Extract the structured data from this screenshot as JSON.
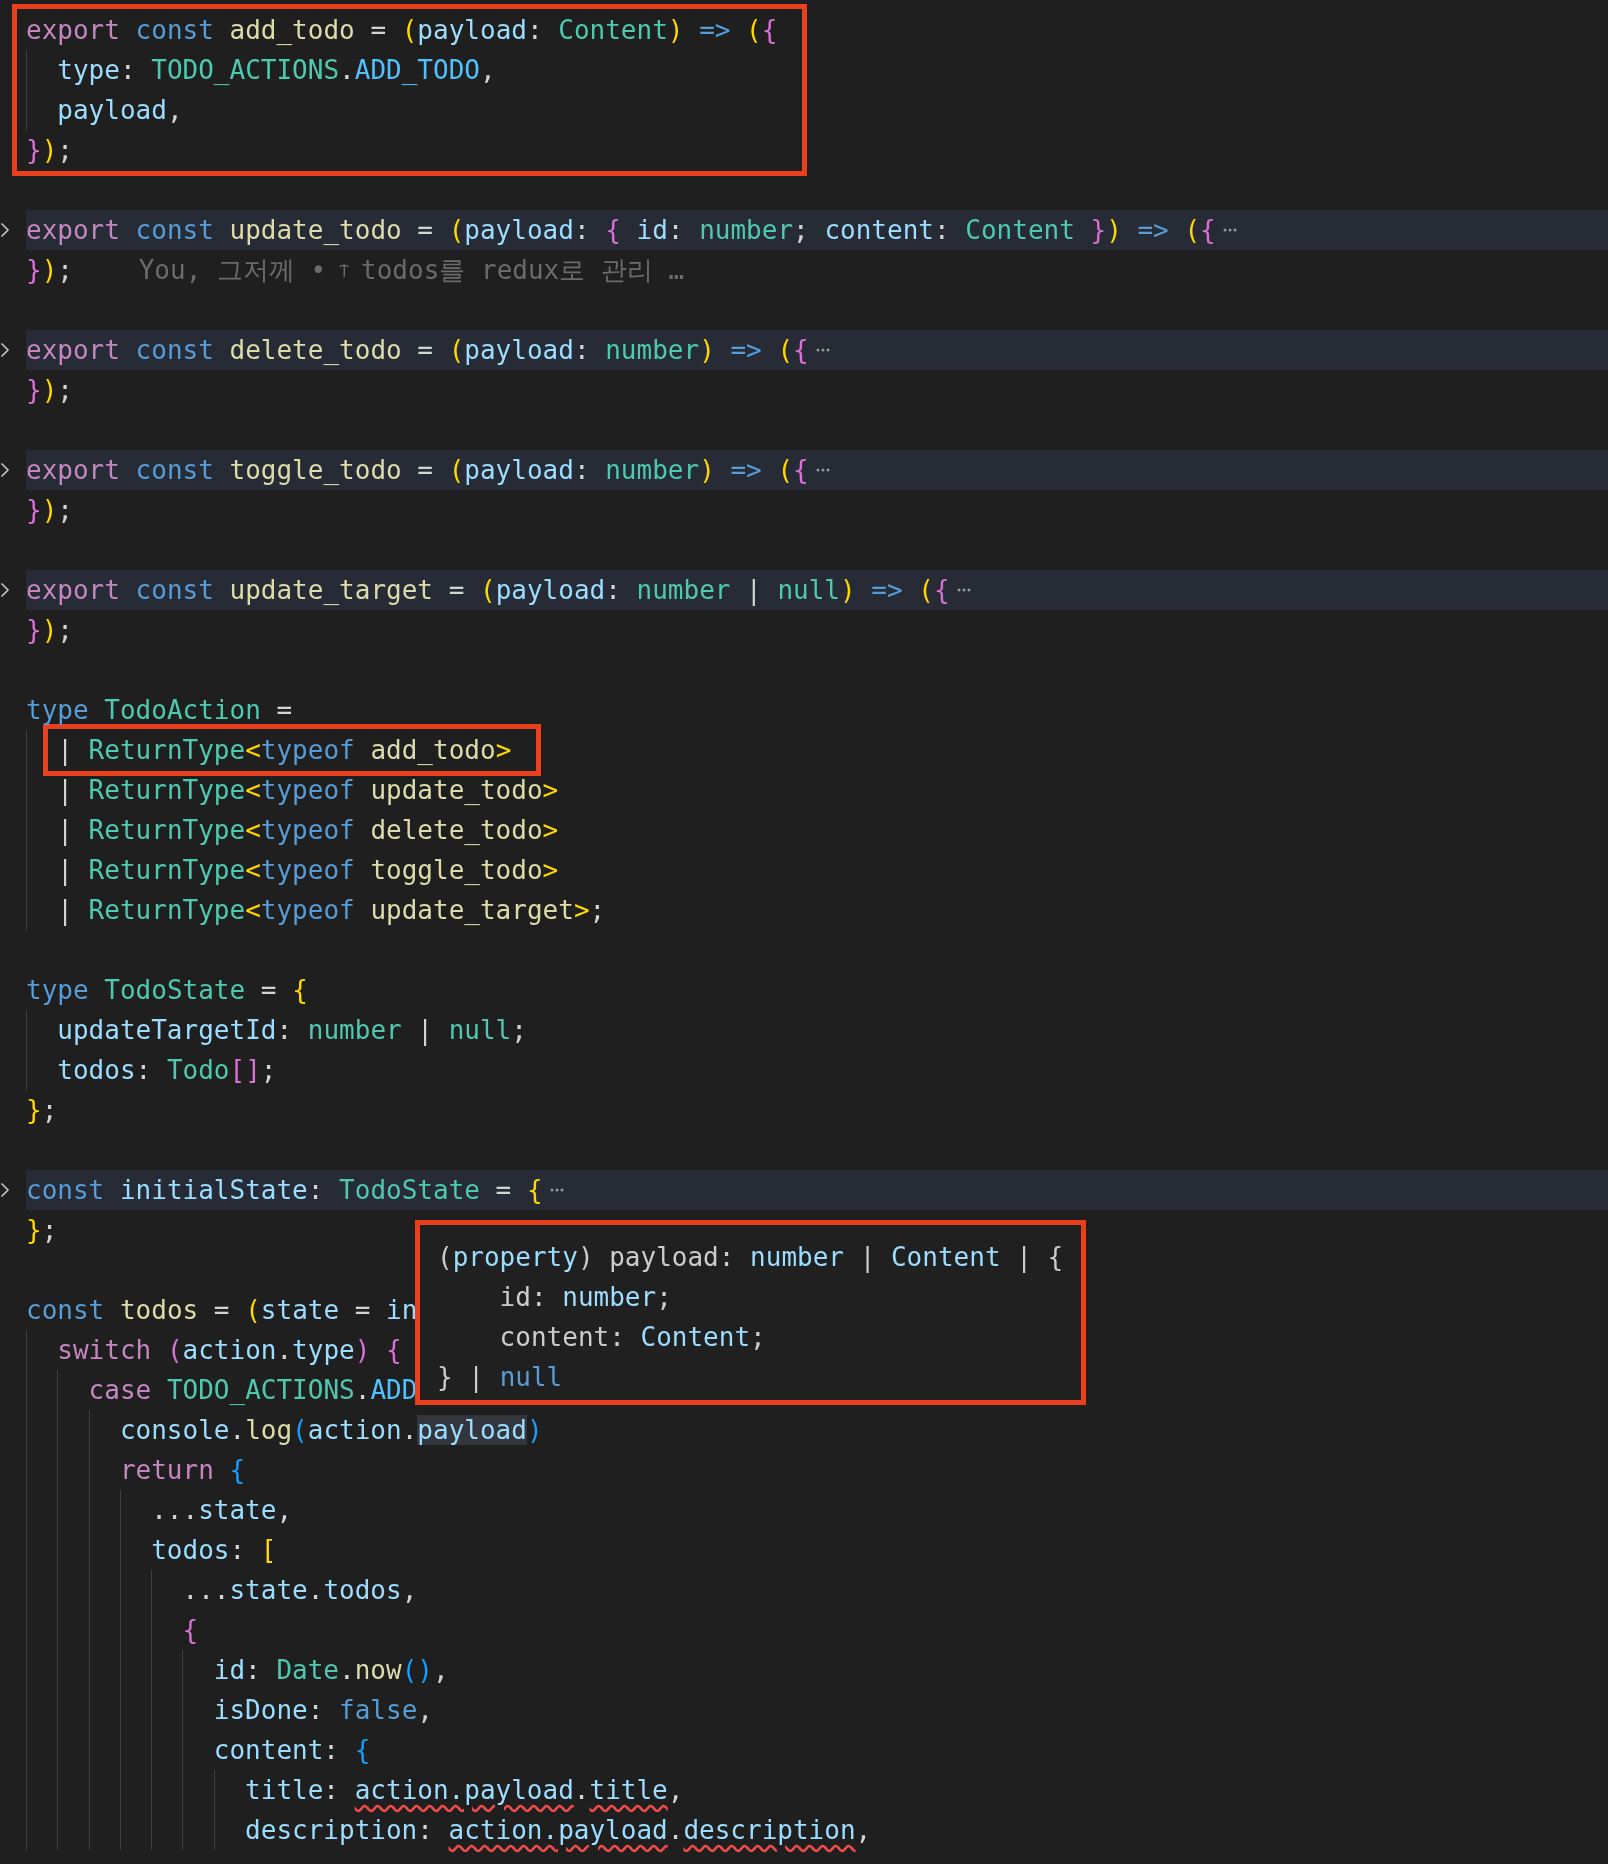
{
  "editor": {
    "lines": [
      {
        "kind": "boxed",
        "tokens": [
          {
            "kind": "kw",
            "text": "export "
          },
          {
            "kind": "st",
            "text": "const "
          },
          {
            "kind": "fn",
            "text": "add_todo"
          },
          {
            "kind": "p",
            "text": " = "
          },
          {
            "kind": "b1",
            "text": "("
          },
          {
            "kind": "var",
            "text": "payload"
          },
          {
            "kind": "p",
            "text": ": "
          },
          {
            "kind": "ty",
            "text": "Content"
          },
          {
            "kind": "b1",
            "text": ") "
          },
          {
            "kind": "st",
            "text": "=> "
          },
          {
            "kind": "b1",
            "text": "("
          },
          {
            "kind": "b2",
            "text": "{"
          }
        ],
        "children": [
          {
            "kind": "plain",
            "tokens": [
              {
                "kind": "var",
                "text": "type"
              },
              {
                "kind": "p",
                "text": ": "
              },
              {
                "kind": "ty",
                "text": "TODO_ACTIONS"
              },
              {
                "kind": "p",
                "text": "."
              },
              {
                "kind": "cn",
                "text": "ADD_TODO"
              },
              {
                "kind": "p",
                "text": ","
              }
            ]
          },
          {
            "kind": "plain",
            "tokens": [
              {
                "kind": "var",
                "text": "payload"
              },
              {
                "kind": "p",
                "text": ","
              }
            ]
          }
        ],
        "close": [
          {
            "kind": "b2",
            "text": "}"
          },
          {
            "kind": "b1",
            "text": ")"
          },
          {
            "kind": "p",
            "text": ";"
          }
        ]
      },
      {
        "kind": "blank"
      },
      {
        "kind": "folded",
        "tokens": [
          {
            "kind": "kw",
            "text": "export "
          },
          {
            "kind": "st",
            "text": "const "
          },
          {
            "kind": "fn",
            "text": "update_todo"
          },
          {
            "kind": "p",
            "text": " = "
          },
          {
            "kind": "b1",
            "text": "("
          },
          {
            "kind": "var",
            "text": "payload"
          },
          {
            "kind": "p",
            "text": ": "
          },
          {
            "kind": "b2",
            "text": "{ "
          },
          {
            "kind": "var",
            "text": "id"
          },
          {
            "kind": "p",
            "text": ": "
          },
          {
            "kind": "ty",
            "text": "number"
          },
          {
            "kind": "p",
            "text": "; "
          },
          {
            "kind": "var",
            "text": "content"
          },
          {
            "kind": "p",
            "text": ": "
          },
          {
            "kind": "ty",
            "text": "Content "
          },
          {
            "kind": "b2",
            "text": "}"
          },
          {
            "kind": "b1",
            "text": ") "
          },
          {
            "kind": "st",
            "text": "=> "
          },
          {
            "kind": "b1",
            "text": "("
          },
          {
            "kind": "b2",
            "text": "{"
          }
        ],
        "close": [
          {
            "kind": "b2",
            "text": "}"
          },
          {
            "kind": "b1",
            "text": ")"
          },
          {
            "kind": "p",
            "text": ";"
          }
        ],
        "blame": {
          "author": "You, 그저께 •",
          "message": "todos를 redux로 관리 …"
        }
      },
      {
        "kind": "blank"
      },
      {
        "kind": "folded",
        "tokens": [
          {
            "kind": "kw",
            "text": "export "
          },
          {
            "kind": "st",
            "text": "const "
          },
          {
            "kind": "fn",
            "text": "delete_todo"
          },
          {
            "kind": "p",
            "text": " = "
          },
          {
            "kind": "b1",
            "text": "("
          },
          {
            "kind": "var",
            "text": "payload"
          },
          {
            "kind": "p",
            "text": ": "
          },
          {
            "kind": "ty",
            "text": "number"
          },
          {
            "kind": "b1",
            "text": ") "
          },
          {
            "kind": "st",
            "text": "=> "
          },
          {
            "kind": "b1",
            "text": "("
          },
          {
            "kind": "b2",
            "text": "{"
          }
        ],
        "close": [
          {
            "kind": "b2",
            "text": "}"
          },
          {
            "kind": "b1",
            "text": ")"
          },
          {
            "kind": "p",
            "text": ";"
          }
        ]
      },
      {
        "kind": "blank"
      },
      {
        "kind": "folded",
        "tokens": [
          {
            "kind": "kw",
            "text": "export "
          },
          {
            "kind": "st",
            "text": "const "
          },
          {
            "kind": "fn",
            "text": "toggle_todo"
          },
          {
            "kind": "p",
            "text": " = "
          },
          {
            "kind": "b1",
            "text": "("
          },
          {
            "kind": "var",
            "text": "payload"
          },
          {
            "kind": "p",
            "text": ": "
          },
          {
            "kind": "ty",
            "text": "number"
          },
          {
            "kind": "b1",
            "text": ") "
          },
          {
            "kind": "st",
            "text": "=> "
          },
          {
            "kind": "b1",
            "text": "("
          },
          {
            "kind": "b2",
            "text": "{"
          }
        ],
        "close": [
          {
            "kind": "b2",
            "text": "}"
          },
          {
            "kind": "b1",
            "text": ")"
          },
          {
            "kind": "p",
            "text": ";"
          }
        ]
      },
      {
        "kind": "blank"
      },
      {
        "kind": "folded",
        "tokens": [
          {
            "kind": "kw",
            "text": "export "
          },
          {
            "kind": "st",
            "text": "const "
          },
          {
            "kind": "fn",
            "text": "update_target"
          },
          {
            "kind": "p",
            "text": " = "
          },
          {
            "kind": "b1",
            "text": "("
          },
          {
            "kind": "var",
            "text": "payload"
          },
          {
            "kind": "p",
            "text": ": "
          },
          {
            "kind": "ty",
            "text": "number"
          },
          {
            "kind": "p",
            "text": " | "
          },
          {
            "kind": "ty",
            "text": "null"
          },
          {
            "kind": "b1",
            "text": ") "
          },
          {
            "kind": "st",
            "text": "=> "
          },
          {
            "kind": "b1",
            "text": "("
          },
          {
            "kind": "b2",
            "text": "{"
          }
        ],
        "close": [
          {
            "kind": "b2",
            "text": "}"
          },
          {
            "kind": "b1",
            "text": ")"
          },
          {
            "kind": "p",
            "text": ";"
          }
        ]
      },
      {
        "kind": "blank"
      },
      {
        "kind": "plain",
        "tokens": [
          {
            "kind": "st",
            "text": "type "
          },
          {
            "kind": "ty",
            "text": "TodoAction"
          },
          {
            "kind": "p",
            "text": " ="
          }
        ],
        "children": [
          {
            "kind": "boxed",
            "tokens": [
              {
                "kind": "p",
                "text": "| "
              },
              {
                "kind": "ty",
                "text": "ReturnType"
              },
              {
                "kind": "b1",
                "text": "<"
              },
              {
                "kind": "st",
                "text": "typeof "
              },
              {
                "kind": "fn",
                "text": "add_todo"
              },
              {
                "kind": "b1",
                "text": ">"
              }
            ]
          },
          {
            "kind": "plain",
            "tokens": [
              {
                "kind": "p",
                "text": "| "
              },
              {
                "kind": "ty",
                "text": "ReturnType"
              },
              {
                "kind": "b1",
                "text": "<"
              },
              {
                "kind": "st",
                "text": "typeof "
              },
              {
                "kind": "fn",
                "text": "update_todo"
              },
              {
                "kind": "b1",
                "text": ">"
              }
            ]
          },
          {
            "kind": "plain",
            "tokens": [
              {
                "kind": "p",
                "text": "| "
              },
              {
                "kind": "ty",
                "text": "ReturnType"
              },
              {
                "kind": "b1",
                "text": "<"
              },
              {
                "kind": "st",
                "text": "typeof "
              },
              {
                "kind": "fn",
                "text": "delete_todo"
              },
              {
                "kind": "b1",
                "text": ">"
              }
            ]
          },
          {
            "kind": "plain",
            "tokens": [
              {
                "kind": "p",
                "text": "| "
              },
              {
                "kind": "ty",
                "text": "ReturnType"
              },
              {
                "kind": "b1",
                "text": "<"
              },
              {
                "kind": "st",
                "text": "typeof "
              },
              {
                "kind": "fn",
                "text": "toggle_todo"
              },
              {
                "kind": "b1",
                "text": ">"
              }
            ]
          },
          {
            "kind": "plain",
            "tokens": [
              {
                "kind": "p",
                "text": "| "
              },
              {
                "kind": "ty",
                "text": "ReturnType"
              },
              {
                "kind": "b1",
                "text": "<"
              },
              {
                "kind": "st",
                "text": "typeof "
              },
              {
                "kind": "fn",
                "text": "update_target"
              },
              {
                "kind": "b1",
                "text": ">"
              },
              {
                "kind": "p",
                "text": ";"
              }
            ]
          }
        ]
      },
      {
        "kind": "blank"
      },
      {
        "kind": "plain",
        "tokens": [
          {
            "kind": "st",
            "text": "type "
          },
          {
            "kind": "ty",
            "text": "TodoState"
          },
          {
            "kind": "p",
            "text": " = "
          },
          {
            "kind": "b1",
            "text": "{"
          }
        ],
        "children": [
          {
            "kind": "plain",
            "tokens": [
              {
                "kind": "var",
                "text": "updateTargetId"
              },
              {
                "kind": "p",
                "text": ": "
              },
              {
                "kind": "ty",
                "text": "number"
              },
              {
                "kind": "p",
                "text": " | "
              },
              {
                "kind": "ty",
                "text": "null"
              },
              {
                "kind": "p",
                "text": ";"
              }
            ]
          },
          {
            "kind": "plain",
            "tokens": [
              {
                "kind": "var",
                "text": "todos"
              },
              {
                "kind": "p",
                "text": ": "
              },
              {
                "kind": "ty",
                "text": "Todo"
              },
              {
                "kind": "b2",
                "text": "[]"
              },
              {
                "kind": "p",
                "text": ";"
              }
            ]
          }
        ],
        "close": [
          {
            "kind": "b1",
            "text": "}"
          },
          {
            "kind": "p",
            "text": ";"
          }
        ]
      },
      {
        "kind": "blank"
      },
      {
        "kind": "folded",
        "tokens": [
          {
            "kind": "st",
            "text": "const "
          },
          {
            "kind": "var",
            "text": "initialState"
          },
          {
            "kind": "p",
            "text": ": "
          },
          {
            "kind": "ty",
            "text": "TodoState"
          },
          {
            "kind": "p",
            "text": " = "
          },
          {
            "kind": "b1",
            "text": "{"
          }
        ],
        "close": [
          {
            "kind": "b1",
            "text": "}"
          },
          {
            "kind": "p",
            "text": ";"
          }
        ]
      },
      {
        "kind": "blank"
      },
      {
        "kind": "plain",
        "tokens": [
          {
            "kind": "st",
            "text": "const "
          },
          {
            "kind": "fn",
            "text": "todos"
          },
          {
            "kind": "p",
            "text": " = "
          },
          {
            "kind": "b1",
            "text": "("
          },
          {
            "kind": "var",
            "text": "state"
          },
          {
            "kind": "p",
            "text": " = "
          },
          {
            "kind": "var",
            "text": "in"
          }
        ],
        "children": [
          {
            "kind": "plain",
            "tokens": [
              {
                "kind": "kw",
                "text": "switch "
              },
              {
                "kind": "b2",
                "text": "("
              },
              {
                "kind": "var",
                "text": "action"
              },
              {
                "kind": "p",
                "text": "."
              },
              {
                "kind": "var",
                "text": "type"
              },
              {
                "kind": "b2",
                "text": ") {"
              }
            ],
            "children": [
              {
                "kind": "plain",
                "tokens": [
                  {
                    "kind": "kw",
                    "text": "case "
                  },
                  {
                    "kind": "ty",
                    "text": "TODO_ACTIONS"
                  },
                  {
                    "kind": "p",
                    "text": "."
                  },
                  {
                    "kind": "cn",
                    "text": "ADD"
                  }
                ],
                "children": [
                  {
                    "kind": "plain",
                    "tokens": [
                      {
                        "kind": "var",
                        "text": "console"
                      },
                      {
                        "kind": "p",
                        "text": "."
                      },
                      {
                        "kind": "fn",
                        "text": "log"
                      },
                      {
                        "kind": "b3",
                        "text": "("
                      },
                      {
                        "kind": "var",
                        "text": "action"
                      },
                      {
                        "kind": "p",
                        "text": "."
                      },
                      {
                        "kind": "hl",
                        "text": "payload"
                      },
                      {
                        "kind": "b3",
                        "text": ")"
                      }
                    ]
                  },
                  {
                    "kind": "plain",
                    "tokens": [
                      {
                        "kind": "kw",
                        "text": "return "
                      },
                      {
                        "kind": "b3",
                        "text": "{"
                      }
                    ],
                    "children": [
                      {
                        "kind": "plain",
                        "tokens": [
                          {
                            "kind": "p",
                            "text": "..."
                          },
                          {
                            "kind": "var",
                            "text": "state"
                          },
                          {
                            "kind": "p",
                            "text": ","
                          }
                        ]
                      },
                      {
                        "kind": "plain",
                        "tokens": [
                          {
                            "kind": "var",
                            "text": "todos"
                          },
                          {
                            "kind": "p",
                            "text": ": "
                          },
                          {
                            "kind": "b1",
                            "text": "["
                          }
                        ],
                        "children": [
                          {
                            "kind": "plain",
                            "tokens": [
                              {
                                "kind": "p",
                                "text": "..."
                              },
                              {
                                "kind": "var",
                                "text": "state"
                              },
                              {
                                "kind": "p",
                                "text": "."
                              },
                              {
                                "kind": "var",
                                "text": "todos"
                              },
                              {
                                "kind": "p",
                                "text": ","
                              }
                            ]
                          },
                          {
                            "kind": "plain",
                            "tokens": [
                              {
                                "kind": "b2",
                                "text": "{"
                              }
                            ],
                            "children": [
                              {
                                "kind": "plain",
                                "tokens": [
                                  {
                                    "kind": "var",
                                    "text": "id"
                                  },
                                  {
                                    "kind": "p",
                                    "text": ": "
                                  },
                                  {
                                    "kind": "ty",
                                    "text": "Date"
                                  },
                                  {
                                    "kind": "p",
                                    "text": "."
                                  },
                                  {
                                    "kind": "fn",
                                    "text": "now"
                                  },
                                  {
                                    "kind": "b3",
                                    "text": "()"
                                  },
                                  {
                                    "kind": "p",
                                    "text": ","
                                  }
                                ]
                              },
                              {
                                "kind": "plain",
                                "tokens": [
                                  {
                                    "kind": "var",
                                    "text": "isDone"
                                  },
                                  {
                                    "kind": "p",
                                    "text": ": "
                                  },
                                  {
                                    "kind": "st",
                                    "text": "false"
                                  },
                                  {
                                    "kind": "p",
                                    "text": ","
                                  }
                                ]
                              },
                              {
                                "kind": "plain",
                                "tokens": [
                                  {
                                    "kind": "var",
                                    "text": "content"
                                  },
                                  {
                                    "kind": "p",
                                    "text": ": "
                                  },
                                  {
                                    "kind": "b3",
                                    "text": "{"
                                  }
                                ],
                                "children": [
                                  {
                                    "kind": "plain",
                                    "tokens": [
                                      {
                                        "kind": "var",
                                        "text": "title"
                                      },
                                      {
                                        "kind": "p",
                                        "text": ": "
                                      },
                                      {
                                        "kind": "err",
                                        "text": "action.payload"
                                      },
                                      {
                                        "kind": "p",
                                        "text": "."
                                      },
                                      {
                                        "kind": "err",
                                        "text": "title"
                                      },
                                      {
                                        "kind": "p",
                                        "text": ","
                                      }
                                    ]
                                  },
                                  {
                                    "kind": "plain",
                                    "tokens": [
                                      {
                                        "kind": "var",
                                        "text": "description"
                                      },
                                      {
                                        "kind": "p",
                                        "text": ": "
                                      },
                                      {
                                        "kind": "err",
                                        "text": "action.payload"
                                      },
                                      {
                                        "kind": "p",
                                        "text": "."
                                      },
                                      {
                                        "kind": "err",
                                        "text": "description"
                                      },
                                      {
                                        "kind": "p",
                                        "text": ","
                                      }
                                    ]
                                  }
                                ]
                              }
                            ]
                          }
                        ]
                      }
                    ]
                  }
                ]
              }
            ]
          }
        ]
      }
    ]
  },
  "hover": {
    "head": [
      {
        "kind": "p",
        "text": "("
      },
      {
        "kind": "var",
        "text": "property"
      },
      {
        "kind": "p",
        "text": ") payload: "
      },
      {
        "kind": "var",
        "text": "number"
      },
      {
        "kind": "p",
        "text": " | "
      },
      {
        "kind": "var",
        "text": "Content"
      },
      {
        "kind": "p",
        "text": " | {"
      }
    ],
    "children": [
      [
        {
          "kind": "p",
          "text": "id: "
        },
        {
          "kind": "var",
          "text": "number"
        },
        {
          "kind": "p",
          "text": ";"
        }
      ],
      [
        {
          "kind": "p",
          "text": "content: "
        },
        {
          "kind": "var",
          "text": "Content"
        },
        {
          "kind": "p",
          "text": ";"
        }
      ]
    ],
    "close": [
      {
        "kind": "p",
        "text": "} | "
      },
      {
        "kind": "st",
        "text": "null"
      }
    ]
  }
}
